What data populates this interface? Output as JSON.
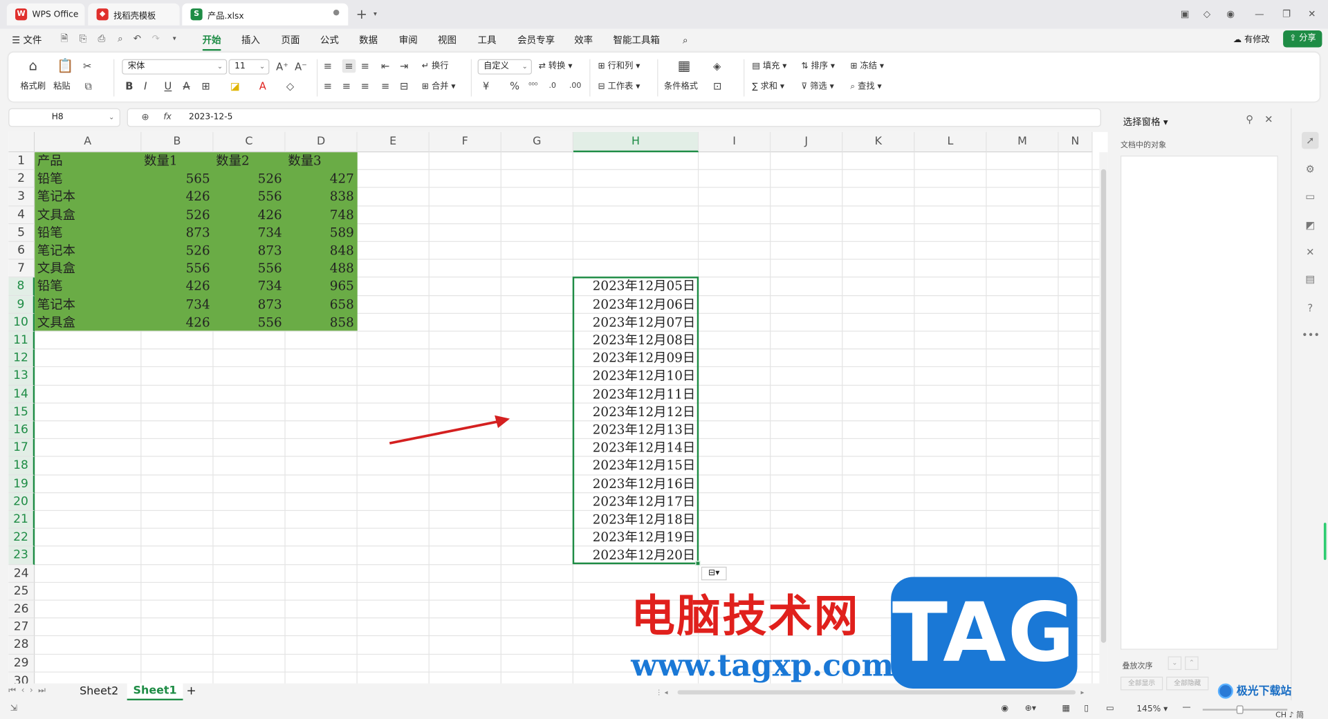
{
  "titlebar": {
    "tabs": [
      {
        "label": "WPS Office",
        "logo": "W"
      },
      {
        "label": "找稻壳模板"
      },
      {
        "label": "产品.xlsx",
        "logo": "S"
      }
    ],
    "new_tab": "+"
  },
  "menubar": {
    "file": "文件",
    "items": [
      "开始",
      "插入",
      "页面",
      "公式",
      "数据",
      "审阅",
      "视图",
      "工具",
      "会员专享",
      "效率",
      "智能工具箱"
    ],
    "active": "开始",
    "modified": "有修改",
    "share": "分享"
  },
  "ribbon": {
    "format_painter": "格式刷",
    "paste": "粘贴",
    "font_name": "宋体",
    "font_size": "11",
    "wrap": "换行",
    "merge": "合并",
    "number_format": "自定义",
    "convert": "转换",
    "row_col": "行和列",
    "worksheet": "工作表",
    "cond_format": "条件格式",
    "fill": "填充",
    "sort": "排序",
    "freeze": "冻结",
    "sum": "求和",
    "filter": "筛选",
    "find": "查找"
  },
  "formula_bar": {
    "name_box": "H8",
    "fx": "fx",
    "value": "2023-12-5"
  },
  "columns": [
    "A",
    "B",
    "C",
    "D",
    "E",
    "F",
    "G",
    "H",
    "I",
    "J",
    "K",
    "L",
    "M",
    "N"
  ],
  "rows": [
    "1",
    "2",
    "3",
    "4",
    "5",
    "6",
    "7",
    "8",
    "9",
    "10",
    "11",
    "12",
    "13",
    "14",
    "15",
    "16",
    "17",
    "18",
    "19",
    "20",
    "21",
    "22",
    "23",
    "24",
    "25",
    "26",
    "27",
    "28",
    "29",
    "30"
  ],
  "table": {
    "headers": [
      "产品",
      "数量1",
      "数量2",
      "数量3"
    ],
    "rows": [
      [
        "铅笔",
        "565",
        "526",
        "427"
      ],
      [
        "笔记本",
        "426",
        "556",
        "838"
      ],
      [
        "文具盒",
        "526",
        "426",
        "748"
      ],
      [
        "铅笔",
        "873",
        "734",
        "589"
      ],
      [
        "笔记本",
        "526",
        "873",
        "848"
      ],
      [
        "文具盒",
        "556",
        "556",
        "488"
      ],
      [
        "铅笔",
        "426",
        "734",
        "965"
      ],
      [
        "笔记本",
        "734",
        "873",
        "658"
      ],
      [
        "文具盒",
        "426",
        "556",
        "858"
      ]
    ],
    "fill_color": "#6aac46"
  },
  "dates": [
    "2023年12月05日",
    "2023年12月06日",
    "2023年12月07日",
    "2023年12月08日",
    "2023年12月09日",
    "2023年12月10日",
    "2023年12月11日",
    "2023年12月12日",
    "2023年12月13日",
    "2023年12月14日",
    "2023年12月15日",
    "2023年12月16日",
    "2023年12月17日",
    "2023年12月18日",
    "2023年12月19日",
    "2023年12月20日"
  ],
  "pane": {
    "title": "选择窗格",
    "objects_label": "文档中的对象",
    "order_label": "叠放次序",
    "show_all": "全部显示",
    "hide_all": "全部隐藏"
  },
  "sheet_tabs": [
    "Sheet2",
    "Sheet1"
  ],
  "active_sheet": "Sheet1",
  "status": {
    "zoom": "145%",
    "ime": "CH ♪ 简"
  },
  "watermark": {
    "site_cn": "电脑技术网",
    "site_url": "www.tagxp.com",
    "tag": "TAG",
    "corner": "极光下载站"
  },
  "accent_color": "#1e8c45"
}
